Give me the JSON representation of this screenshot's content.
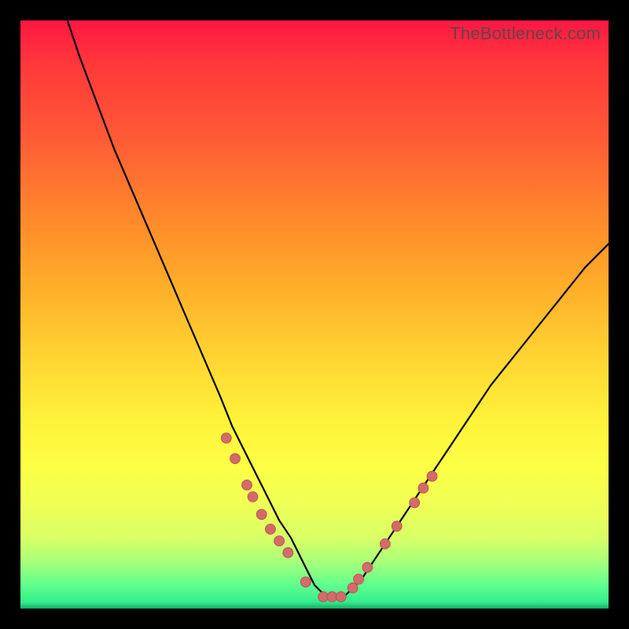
{
  "watermark": "TheBottleneck.com",
  "colors": {
    "page_bg": "#000000",
    "gradient_top": "#ff1744",
    "gradient_mid": "#ffd733",
    "gradient_bottom": "#23e68b",
    "curve": "#000000",
    "marker_fill": "#d46a6a",
    "marker_stroke": "#b04f4f"
  },
  "chart_data": {
    "type": "line",
    "title": "",
    "xlabel": "",
    "ylabel": "",
    "xlim": [
      0,
      100
    ],
    "ylim": [
      0,
      100
    ],
    "legend": false,
    "grid": false,
    "annotations": [],
    "series": [
      {
        "name": "curve",
        "x": [
          8,
          10,
          13,
          16,
          19,
          22,
          25,
          28,
          31,
          34,
          36,
          38,
          40,
          42,
          44,
          46,
          48,
          49,
          50,
          51,
          52,
          53,
          55,
          56,
          58,
          60,
          62,
          64,
          66,
          68,
          72,
          76,
          80,
          84,
          88,
          92,
          96,
          100
        ],
        "y": [
          100,
          94,
          86,
          78,
          71,
          64,
          57,
          50,
          43,
          36,
          31,
          27,
          23,
          19,
          15,
          12,
          8,
          6,
          4,
          3,
          2,
          2,
          2,
          3,
          5,
          8,
          11,
          14,
          17,
          20,
          26,
          32,
          38,
          43,
          48,
          53,
          58,
          62
        ]
      },
      {
        "name": "markers",
        "x": [
          35.0,
          36.5,
          38.5,
          39.5,
          41.0,
          42.5,
          44.0,
          45.5,
          48.5,
          51.5,
          53.0,
          54.5,
          56.5,
          57.5,
          59.0,
          62.0,
          64.0,
          67.0,
          68.5,
          70.0
        ],
        "y": [
          29.0,
          25.5,
          21.0,
          19.0,
          16.0,
          13.5,
          11.5,
          9.5,
          4.5,
          2.0,
          2.0,
          2.0,
          3.5,
          5.0,
          7.0,
          11.0,
          14.0,
          18.0,
          20.5,
          22.5
        ]
      }
    ]
  }
}
